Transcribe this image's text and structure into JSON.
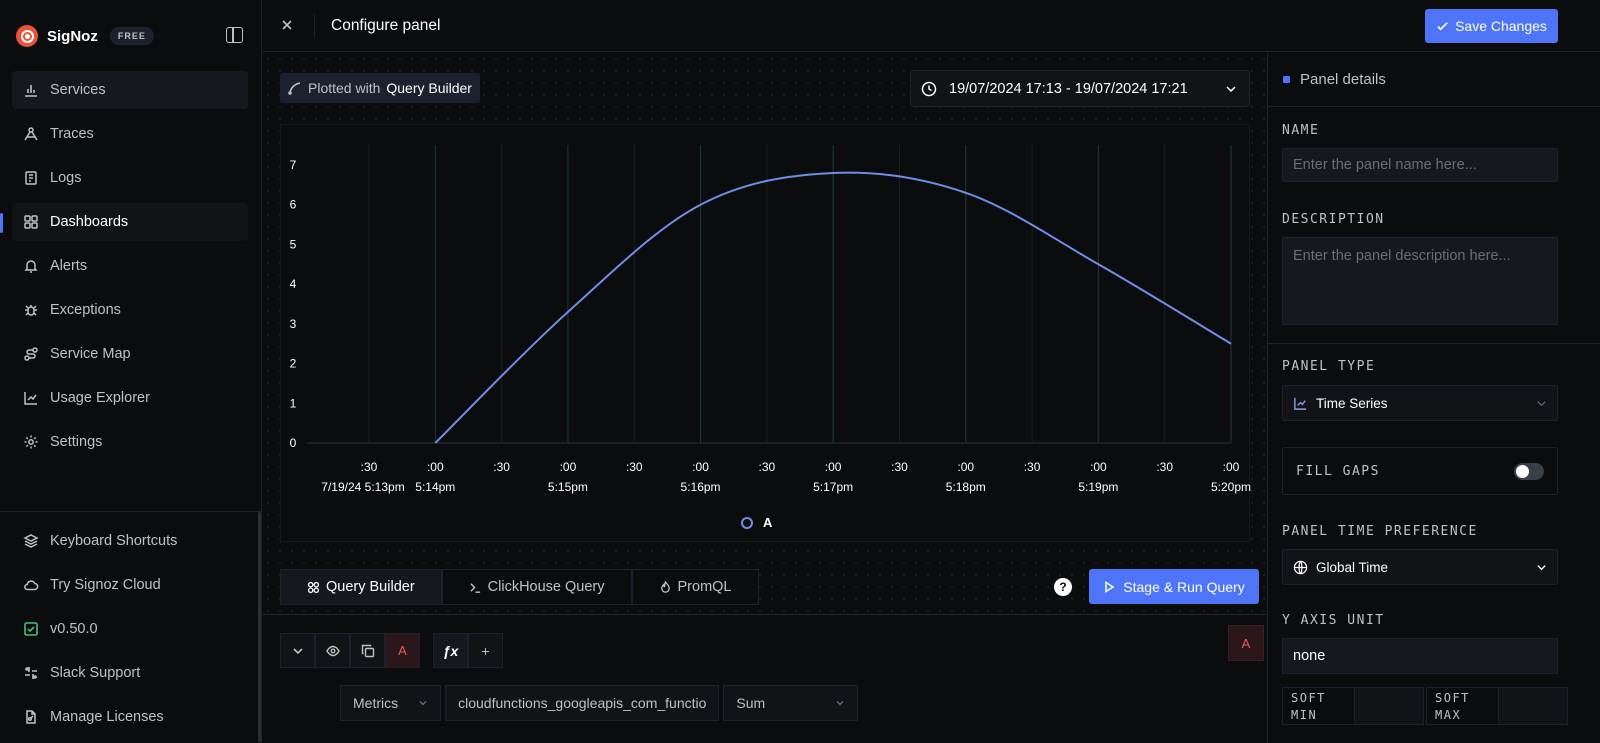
{
  "brand": {
    "name": "SigNoz",
    "badge": "FREE"
  },
  "nav": {
    "items": [
      {
        "label": "Services",
        "icon": "bar-chart-icon"
      },
      {
        "label": "Traces",
        "icon": "draft-icon"
      },
      {
        "label": "Logs",
        "icon": "scroll-text-icon"
      },
      {
        "label": "Dashboards",
        "icon": "layout-grid-icon"
      },
      {
        "label": "Alerts",
        "icon": "bell-dot-icon"
      },
      {
        "label": "Exceptions",
        "icon": "bug-icon"
      },
      {
        "label": "Service Map",
        "icon": "route-icon"
      },
      {
        "label": "Usage Explorer",
        "icon": "line-chart-icon"
      },
      {
        "label": "Settings",
        "icon": "gear-icon"
      }
    ],
    "bottom": [
      {
        "label": "Keyboard Shortcuts",
        "icon": "layers-icon"
      },
      {
        "label": "Try Signoz Cloud",
        "icon": "cloud-icon"
      },
      {
        "label": "v0.50.0",
        "icon": "check-square-icon"
      },
      {
        "label": "Slack Support",
        "icon": "slack-icon"
      },
      {
        "label": "Manage Licenses",
        "icon": "file-key-icon"
      }
    ]
  },
  "header": {
    "title": "Configure panel",
    "save_label": "Save Changes"
  },
  "toolbar": {
    "plotted_prefix": "Plotted with",
    "plotted_source": "Query Builder",
    "time_range": "19/07/2024 17:13 - 19/07/2024 17:21"
  },
  "chart_data": {
    "type": "line",
    "title": "",
    "xlabel": "",
    "ylabel": "",
    "ylim": [
      0,
      7
    ],
    "y_ticks": [
      "0",
      "1",
      "2",
      "3",
      "4",
      "5",
      "6",
      "7"
    ],
    "x_ticks": [
      {
        "top": ":30",
        "bottom": "7/19/24 5:13pm"
      },
      {
        "top": ":00",
        "bottom": "5:14pm"
      },
      {
        "top": ":30",
        "bottom": ""
      },
      {
        "top": ":00",
        "bottom": "5:15pm"
      },
      {
        "top": ":30",
        "bottom": ""
      },
      {
        "top": ":00",
        "bottom": "5:16pm"
      },
      {
        "top": ":30",
        "bottom": ""
      },
      {
        "top": ":00",
        "bottom": "5:17pm"
      },
      {
        "top": ":30",
        "bottom": ""
      },
      {
        "top": ":00",
        "bottom": "5:18pm"
      },
      {
        "top": ":30",
        "bottom": ""
      },
      {
        "top": ":00",
        "bottom": "5:19pm"
      },
      {
        "top": ":30",
        "bottom": ""
      },
      {
        "top": ":00",
        "bottom": "5:20pm"
      }
    ],
    "series": [
      {
        "name": "A",
        "color": "#6f8ee8",
        "x": [
          "5:14:00",
          "5:15:00",
          "5:16:00",
          "5:17:00",
          "5:18:00",
          "5:19:00",
          "5:20:00"
        ],
        "values": [
          0,
          3.3,
          6.0,
          6.8,
          6.3,
          4.5,
          2.5
        ]
      }
    ],
    "grid": true,
    "legend": "bottom-center"
  },
  "query": {
    "tabs": [
      "Query Builder",
      "ClickHouse Query",
      "PromQL"
    ],
    "run_label": "Stage & Run Query",
    "help": "?",
    "letter": "A",
    "fx": "ƒx",
    "add": "+",
    "data_source": "Metrics",
    "metric": "cloudfunctions_googleapis_com_functio",
    "aggregation": "Sum"
  },
  "panel": {
    "section_title": "Panel details",
    "name_label": "NAME",
    "name_placeholder": "Enter the panel name here...",
    "description_label": "DESCRIPTION",
    "description_placeholder": "Enter the panel description here...",
    "type_label": "PANEL TYPE",
    "type_value": "Time Series",
    "fill_gaps_label": "FILL GAPS",
    "fill_gaps_enabled": false,
    "time_pref_label": "PANEL TIME PREFERENCE",
    "time_pref_value": "Global Time",
    "y_unit_label": "Y AXIS UNIT",
    "y_unit_value": "none",
    "soft_min_label": "SOFT MIN",
    "soft_max_label": "SOFT MAX"
  }
}
